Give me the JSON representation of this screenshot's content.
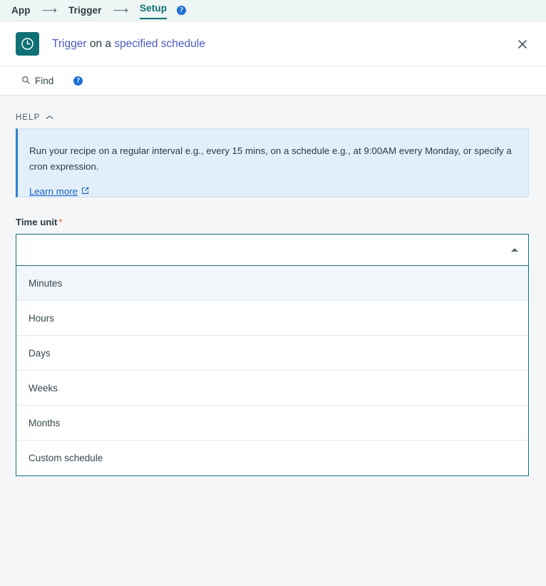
{
  "breadcrumb": {
    "items": [
      {
        "label": "App",
        "active": false
      },
      {
        "label": "Trigger",
        "active": false
      },
      {
        "label": "Setup",
        "active": true
      }
    ],
    "arrow": "⟶",
    "help_icon_label": "?"
  },
  "header": {
    "icon": "clock-icon",
    "title_prefix": "Trigger",
    "title_middle": " on a ",
    "title_suffix": "specified schedule",
    "close_label": "close-icon",
    "icon_bg": "#0f7076"
  },
  "toolbar": {
    "find_label": "Find",
    "find_icon": "search-icon",
    "help_icon_label": "?"
  },
  "help": {
    "section_label": "HELP",
    "chevron": "∧",
    "body": "Run your recipe on a regular interval e.g., every 15 mins, on a schedule e.g., at 9:00AM every Monday, or specify a cron expression.",
    "link_label": "Learn more",
    "link_icon": "external-link-icon",
    "panel_bg": "#e2eef9",
    "accent": "#2d7fd3"
  },
  "field": {
    "label": "Time unit",
    "required_marker": "*",
    "value": "",
    "placeholder": "",
    "caret_icon": "caret-up-icon",
    "focus_color": "#15707a"
  },
  "dropdown": {
    "options": [
      {
        "label": "Minutes",
        "highlighted": true
      },
      {
        "label": "Hours",
        "highlighted": false
      },
      {
        "label": "Days",
        "highlighted": false
      },
      {
        "label": "Weeks",
        "highlighted": false
      },
      {
        "label": "Months",
        "highlighted": false
      },
      {
        "label": "Custom schedule",
        "highlighted": false
      }
    ]
  }
}
